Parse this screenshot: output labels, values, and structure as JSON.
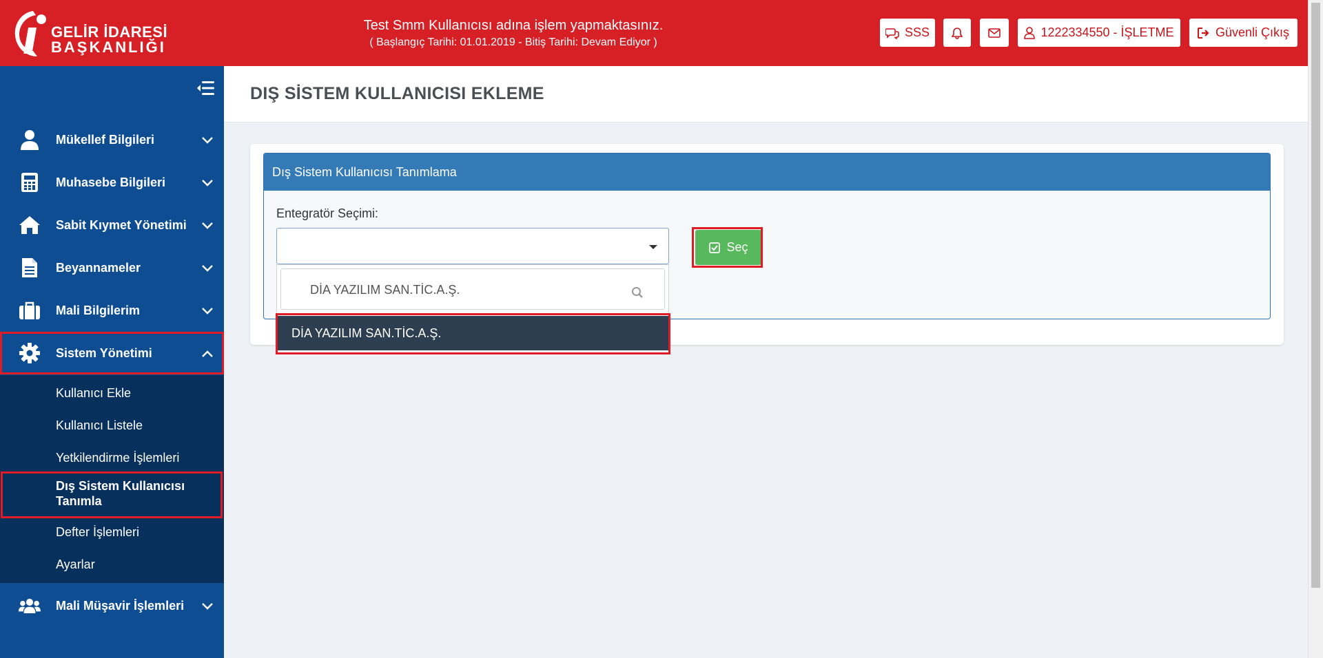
{
  "header": {
    "logo": {
      "line1": "GELİR İDARESİ",
      "line2": "BAŞKANLIĞI"
    },
    "notice_line1": "Test Smm Kullanıcısı adına işlem yapmaktasınız.",
    "notice_line2": "( Başlangıç Tarihi: 01.01.2019 - Bitiş Tarihi: Devam Ediyor )",
    "buttons": {
      "faq": {
        "label": "SSS",
        "icon": "chat-icon"
      },
      "notifications": {
        "icon": "bell-icon"
      },
      "messages": {
        "icon": "envelope-icon"
      },
      "user": {
        "label": "1222334550 - İŞLETME",
        "icon": "user-icon"
      },
      "logout": {
        "label": "Güvenli Çıkış",
        "icon": "sign-out-icon"
      }
    }
  },
  "sidebar": {
    "items": [
      {
        "label": "Mükellef Bilgileri",
        "icon": "user-icon"
      },
      {
        "label": "Muhasebe Bilgileri",
        "icon": "calculator-icon"
      },
      {
        "label": "Sabit Kıymet Yönetimi",
        "icon": "home-icon"
      },
      {
        "label": "Beyannameler",
        "icon": "document-icon"
      },
      {
        "label": "Mali Bilgilerim",
        "icon": "briefcase-icon"
      },
      {
        "label": "Sistem Yönetimi",
        "icon": "gear-icon",
        "expanded": true
      },
      {
        "label": "Mali Müşavir İşlemleri",
        "icon": "users-icon"
      }
    ],
    "sub_items": [
      {
        "label": "Kullanıcı Ekle"
      },
      {
        "label": "Kullanıcı Listele"
      },
      {
        "label": "Yetkilendirme İşlemleri"
      },
      {
        "label": "Dış Sistem Kullanıcısı Tanımla",
        "active": true
      },
      {
        "label": "Defter İşlemleri"
      },
      {
        "label": "Ayarlar"
      }
    ]
  },
  "main": {
    "page_title": "DIŞ SİSTEM KULLANICISI EKLEME",
    "panel_title": "Dış Sistem Kullanıcısı Tanımlama",
    "field_label": "Entegratör Seçimi:",
    "select_value": "",
    "search_value": "DİA YAZILIM SAN.TİC.A.Ş.",
    "options": [
      "DİA YAZILIM SAN.TİC.A.Ş."
    ],
    "select_button": "Seç"
  },
  "colors": {
    "header_red": "#d71f26",
    "sidebar_blue": "#0e4d92",
    "submenu_navy": "#08305d",
    "panel_blue": "#347ab7",
    "button_green": "#58b85c",
    "highlight_red": "#e01b24",
    "option_dark": "#2c3e50"
  }
}
